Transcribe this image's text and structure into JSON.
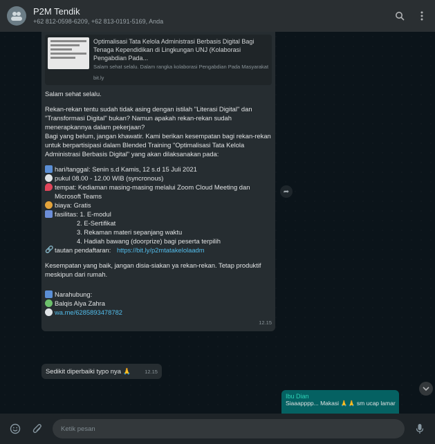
{
  "header": {
    "title": "P2M Tendik",
    "subtitle": "+62 812-0598-6209, +62 813-0191-5169, Anda",
    "icons": [
      "group-avatar-icon",
      "search-icon",
      "menu-dots-icon"
    ]
  },
  "message": {
    "preview": {
      "title": "Optimalisasi Tata Kelola Administrasi Berbasis Digital Bagi Tenaga Kependidikan di Lingkungan UNJ (Kolaborasi Pengabdian Pada...",
      "desc": "Salam sehat selalu. Dalam rangka kolaborasi Pengabdian Pada Masyarakat",
      "domain": "bit.ly"
    },
    "greeting": "Salam sehat selalu.",
    "para1": "Rekan-rekan tentu sudah tidak asing dengan istilah \"Literasi Digital\" dan \"Transformasi Digital\" bukan? Namun apakah rekan-rekan sudah menerapkannya dalam pekerjaan?",
    "para2": "Bagi yang belum, jangan khawatir. Kami berikan kesempatan bagi rekan-rekan untuk berpartisipasi dalam Blended Training \"Optimalisasi Tata Kelola Administrasi Berbasis Digital\" yang akan dilaksanakan pada:",
    "date": "hari/tanggal: Senin s.d Kamis, 12 s.d 15 Juli 2021",
    "time_info": "pukul 08.00 - 12.00 WIB (syncronous)",
    "place": "tempat: Kediaman masing-masing melalui Zoom Cloud Meeting dan Microsoft Teams",
    "cost": "biaya: Gratis",
    "facilities_label": "fasilitas: 1. E-modul",
    "fac2": "2. E-Sertifikat",
    "fac3": "3. Rekaman materi sepanjang waktu",
    "fac4": "4. Hadiah bawang (doorprize) bagi peserta terpilih",
    "reg_label": "tautan pendaftaran:",
    "reg_link": "https://bit.ly/p2mtatakelolaadm",
    "closing": "Kesempatan yang baik, jangan disia-siakan ya rekan-rekan. Tetap produktif meskipun dari rumah.",
    "contact_label": "Narahubung:",
    "contact_name": "Balqis Alya Zahra",
    "contact_link": "wa.me/6285893478782",
    "timestamp": "12.15"
  },
  "message2": {
    "text": "Sedikit diperbaiki typo nya 🙏",
    "timestamp": "12.15"
  },
  "reply_preview": {
    "name": "Ibu Dian",
    "text": "Siaaapppp... Makasi 🙏🙏 sm ucap lamar"
  },
  "footer": {
    "placeholder": "Ketik pesan"
  },
  "colors": {
    "header_bg": "#2a2f32",
    "bubble_bg": "#262d31",
    "link": "#53bdeb",
    "reply_bg": "#056162"
  }
}
